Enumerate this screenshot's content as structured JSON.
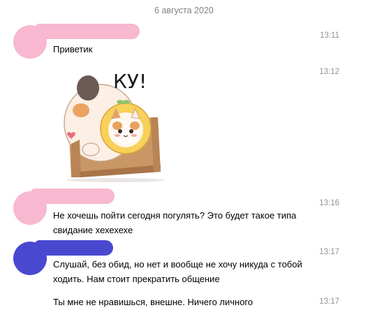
{
  "date_separator": "6 августа 2020",
  "messages": [
    {
      "time": "13:11",
      "text": "Приветик"
    },
    {
      "time": "13:12",
      "sticker_text": "КУ!"
    },
    {
      "time": "13:16",
      "text": "Не хочешь пойти сегодня погулять? Это будет такое типа свидание хехехехе"
    },
    {
      "time": "13:17",
      "text": "Слушай, без обид, но нет и вообще не хочу никуда с тобой ходить. Нам стоит прекратить общение"
    },
    {
      "time": "13:17",
      "text": "Ты мне не нравишься, внешне. Ничего личного"
    }
  ],
  "colors": {
    "censor_pink": "#f7b8d0",
    "censor_blue": "#4949d0",
    "timestamp": "#939393",
    "date": "#828282"
  }
}
